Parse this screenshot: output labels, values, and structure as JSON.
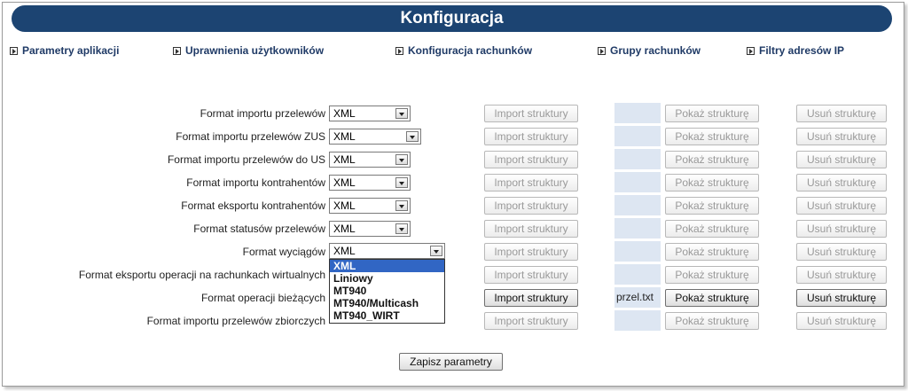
{
  "title": "Konfiguracja",
  "nav": [
    {
      "label": "Parametry aplikacji"
    },
    {
      "label": "Uprawnienia użytkowników"
    },
    {
      "label": "Konfiguracja rachunków"
    },
    {
      "label": "Grupy rachunków"
    },
    {
      "label": "Filtry adresów IP"
    }
  ],
  "buttons": {
    "import": "Import struktury",
    "show": "Pokaż strukturę",
    "delete": "Usuń strukturę"
  },
  "rows": [
    {
      "label": "Format importu przelewów",
      "value": "XML",
      "file": ""
    },
    {
      "label": "Format importu przelewów ZUS",
      "value": "XML",
      "file": ""
    },
    {
      "label": "Format importu przelewów do US",
      "value": "XML",
      "file": ""
    },
    {
      "label": "Format importu kontrahentów",
      "value": "XML",
      "file": ""
    },
    {
      "label": "Format eksportu kontrahentów",
      "value": "XML",
      "file": ""
    },
    {
      "label": "Format statusów przelewów",
      "value": "XML",
      "file": ""
    },
    {
      "label": "Format wyciągów",
      "value": "XML",
      "file": ""
    },
    {
      "label": "Format eksportu operacji na rachunkach wirtualnych",
      "value": "",
      "file": ""
    },
    {
      "label": "Format operacji bieżących",
      "value": "",
      "file": "przel.txt"
    },
    {
      "label": "Format importu przelewów zbiorczych",
      "value": "",
      "file": ""
    }
  ],
  "dropdown_options": [
    "XML",
    "Liniowy",
    "MT940",
    "MT940/Multicash",
    "MT940_WIRT"
  ],
  "save_label": "Zapisz parametry"
}
